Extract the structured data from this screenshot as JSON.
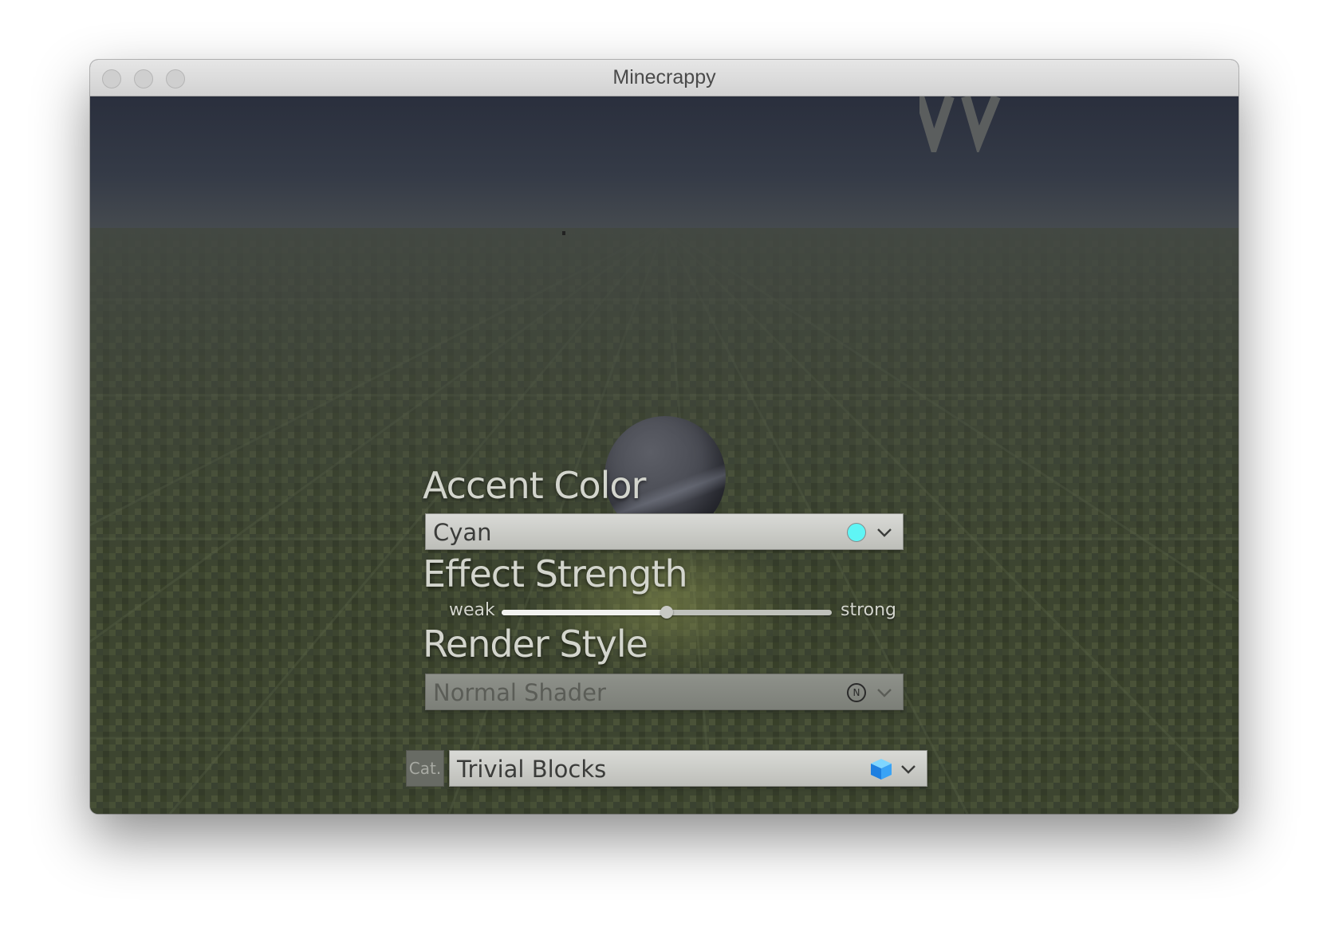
{
  "window": {
    "title": "Minecrappy"
  },
  "accent": {
    "heading": "Accent Color",
    "selected": "Cyan",
    "swatch_color": "#5ff5f5",
    "icon": "chevron-down-icon"
  },
  "effect": {
    "heading": "Effect Strength",
    "min_label": "weak",
    "max_label": "strong",
    "value_fraction": 0.5
  },
  "render": {
    "heading": "Render Style",
    "selected": "Normal Shader",
    "enabled": false,
    "icon_glyph": "N"
  },
  "category": {
    "button_label": "Cat.",
    "selected": "Trivial Blocks",
    "item_icon": "cube-icon"
  }
}
